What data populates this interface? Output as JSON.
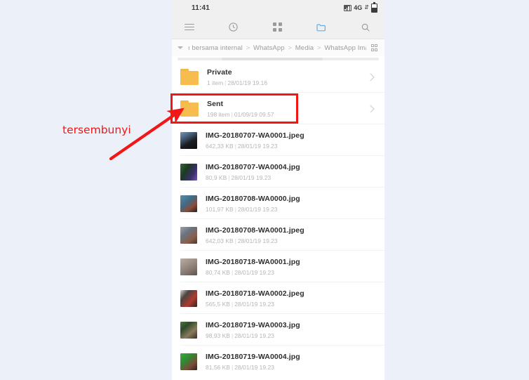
{
  "status_bar": {
    "time": "11:41",
    "network_label": "4G",
    "signal_icon": "signal-bars-icon",
    "data_arrows_icon": "data-transfer-arrows-icon",
    "battery_icon": "battery-icon"
  },
  "toolbar": {
    "items": [
      {
        "name": "menu-icon",
        "label": "Menu"
      },
      {
        "name": "recent-icon",
        "label": "Recent"
      },
      {
        "name": "categories-icon",
        "label": "Categories"
      },
      {
        "name": "folders-icon",
        "label": "Folders"
      },
      {
        "name": "search-icon",
        "label": "Search"
      }
    ],
    "active_index": 3
  },
  "breadcrumb": {
    "expand_icon": "chevron-down-icon",
    "segments": [
      "ı bersama internal",
      "WhatsApp",
      "Media",
      "WhatsApp Image"
    ],
    "separator": ">",
    "view_toggle_icon": "grid-view-icon"
  },
  "list": {
    "rows": [
      {
        "type": "folder",
        "name": "Private",
        "meta": "1 item",
        "date": "28/01/19 19.16",
        "chevron": true,
        "thumb": "#f6bd4e"
      },
      {
        "type": "folder",
        "name": "Sent",
        "meta": "198 item",
        "date": "01/09/19 09.57",
        "chevron": true,
        "thumb": "#f6bd4e",
        "highlighted": true
      },
      {
        "type": "file",
        "name": "IMG-20180707-WA0001.jpeg",
        "meta": "642,33 KB",
        "date": "28/01/19 19.23",
        "chevron": false,
        "thumb": "linear-gradient(150deg,#7a93ad 0%,#46607a 30%,#1b1d22 60%,#0d0e10 100%)"
      },
      {
        "type": "file",
        "name": "IMG-20180707-WA0004.jpg",
        "meta": "80,9 KB",
        "date": "28/01/19 19.23",
        "chevron": false,
        "thumb": "linear-gradient(120deg,#2f6b3a 0%,#1d3a22 35%,#3a2f6b 70%,#6b5ba8 100%)"
      },
      {
        "type": "file",
        "name": "IMG-20180708-WA0000.jpg",
        "meta": "101,97 KB",
        "date": "28/01/19 19.23",
        "chevron": false,
        "thumb": "linear-gradient(140deg,#5d8ba5 0%,#3f6b85 40%,#8b4a3a 70%,#241f1c 100%)"
      },
      {
        "type": "file",
        "name": "IMG-20180708-WA0001.jpeg",
        "meta": "642,03 KB",
        "date": "28/01/19 19.23",
        "chevron": false,
        "thumb": "linear-gradient(140deg,#9aa3ad 0%,#6b7480 35%,#8a5d4a 70%,#4a3a30 100%)"
      },
      {
        "type": "file",
        "name": "IMG-20180718-WA0001.jpg",
        "meta": "80,74 KB",
        "date": "28/01/19 19.23",
        "chevron": false,
        "thumb": "linear-gradient(150deg,#b9aca3 0%,#9b8e85 40%,#7d6f66 75%,#5c5149 100%)"
      },
      {
        "type": "file",
        "name": "IMG-20180718-WA0002.jpeg",
        "meta": "565,5 KB",
        "date": "28/01/19 19.23",
        "chevron": false,
        "thumb": "linear-gradient(130deg,#d8d4d0 0%,#4a4440 30%,#b03a2e 65%,#2b2724 100%)"
      },
      {
        "type": "file",
        "name": "IMG-20180719-WA0003.jpg",
        "meta": "98,93 KB",
        "date": "28/01/19 19.23",
        "chevron": false,
        "thumb": "linear-gradient(140deg,#4e7a3e 0%,#2f4a2a 30%,#8a7a5e 65%,#3a3028 100%)"
      },
      {
        "type": "file",
        "name": "IMG-20180719-WA0004.jpg",
        "meta": "81,56 KB",
        "date": "28/01/19 19.23",
        "chevron": false,
        "thumb": "linear-gradient(140deg,#3fa83f 0%,#2e8c33 35%,#7a4a3a 70%,#2b2420 100%)"
      }
    ]
  },
  "annotation": {
    "label": "tersembunyi",
    "color": "#f31616",
    "arrow_icon": "arrow-pointing-up-right-icon",
    "highlight_target": "Sent"
  }
}
